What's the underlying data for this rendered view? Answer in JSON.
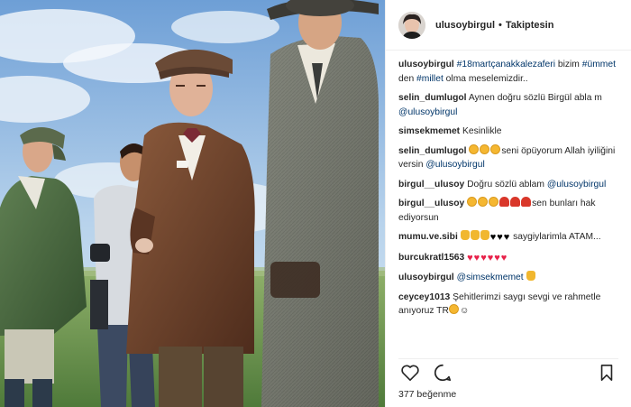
{
  "header": {
    "username": "ulusoybirgul",
    "separator": "•",
    "follow_status": "Takiptesin",
    "avatar_icon": "profile-photo-icon"
  },
  "comments": [
    {
      "user": "ulusoybirgul",
      "parts": [
        {
          "t": "tag",
          "v": "#18martçanakkalezaferi"
        },
        {
          "t": "text",
          "v": " bizim "
        },
        {
          "t": "tag",
          "v": "#ümmet"
        },
        {
          "t": "text",
          "v": " den "
        },
        {
          "t": "tag",
          "v": "#millet"
        },
        {
          "t": "text",
          "v": " olma meselemizdir.."
        }
      ]
    },
    {
      "user": "selin_dumlugol",
      "parts": [
        {
          "t": "text",
          "v": "Aynen doğru sözlü Birgül abla m "
        },
        {
          "t": "tag",
          "v": "@ulusoybirgul"
        }
      ]
    },
    {
      "user": "simsekmemet",
      "parts": [
        {
          "t": "text",
          "v": "Kesinlikle"
        }
      ]
    },
    {
      "user": "selin_dumlugol",
      "parts": [
        {
          "t": "emoji",
          "v": "face"
        },
        {
          "t": "emoji",
          "v": "face"
        },
        {
          "t": "emoji",
          "v": "face"
        },
        {
          "t": "text",
          "v": "seni öpüyorum Allah iyiliğini versin "
        },
        {
          "t": "tag",
          "v": "@ulusoybirgul"
        }
      ]
    },
    {
      "user": "birgul__ulusoy",
      "parts": [
        {
          "t": "text",
          "v": "Doğru sözlü ablam "
        },
        {
          "t": "tag",
          "v": "@ulusoybirgul"
        }
      ]
    },
    {
      "user": "birgul__ulusoy",
      "parts": [
        {
          "t": "emoji",
          "v": "face"
        },
        {
          "t": "emoji",
          "v": "face"
        },
        {
          "t": "emoji",
          "v": "face"
        },
        {
          "t": "emoji",
          "v": "rose"
        },
        {
          "t": "emoji",
          "v": "rose"
        },
        {
          "t": "emoji",
          "v": "rose"
        },
        {
          "t": "text",
          "v": "sen bunları hak ediyorsun"
        }
      ]
    },
    {
      "user": "mumu.ve.sibi",
      "parts": [
        {
          "t": "emoji",
          "v": "thumb"
        },
        {
          "t": "emoji",
          "v": "thumb"
        },
        {
          "t": "emoji",
          "v": "thumb"
        },
        {
          "t": "emoji",
          "v": "heart-b"
        },
        {
          "t": "emoji",
          "v": "heart-b"
        },
        {
          "t": "emoji",
          "v": "heart-b"
        },
        {
          "t": "text",
          "v": " saygiylarimla ATAM..."
        }
      ]
    },
    {
      "user": "burcukratl1563",
      "parts": [
        {
          "t": "emoji",
          "v": "heart-r"
        },
        {
          "t": "emoji",
          "v": "heart-r"
        },
        {
          "t": "emoji",
          "v": "heart-r"
        },
        {
          "t": "emoji",
          "v": "heart-r"
        },
        {
          "t": "emoji",
          "v": "heart-r"
        },
        {
          "t": "emoji",
          "v": "heart-r"
        }
      ]
    },
    {
      "user": "ulusoybirgul",
      "parts": [
        {
          "t": "tag",
          "v": "@simsekmemet"
        },
        {
          "t": "text",
          "v": " "
        },
        {
          "t": "emoji",
          "v": "thumb"
        }
      ]
    },
    {
      "user": "ceycey1013",
      "parts": [
        {
          "t": "text",
          "v": "Şehitlerimzi saygı sevgi ve rahmetle anıyoruz TR"
        },
        {
          "t": "emoji",
          "v": "face"
        },
        {
          "t": "text",
          "v": "☺"
        }
      ]
    }
  ],
  "actions": {
    "like_icon": "heart-outline-icon",
    "comment_icon": "comment-bubble-icon",
    "save_icon": "bookmark-icon"
  },
  "likes_text": "377 beğenme",
  "colors": {
    "text": "#262626",
    "tag": "#003569",
    "border": "#efefef",
    "sky_top": "#7aa6d8",
    "grass": "#6f9a56"
  },
  "emoji_glyphs": {
    "heart-r": "♥",
    "heart-b": "♥"
  }
}
